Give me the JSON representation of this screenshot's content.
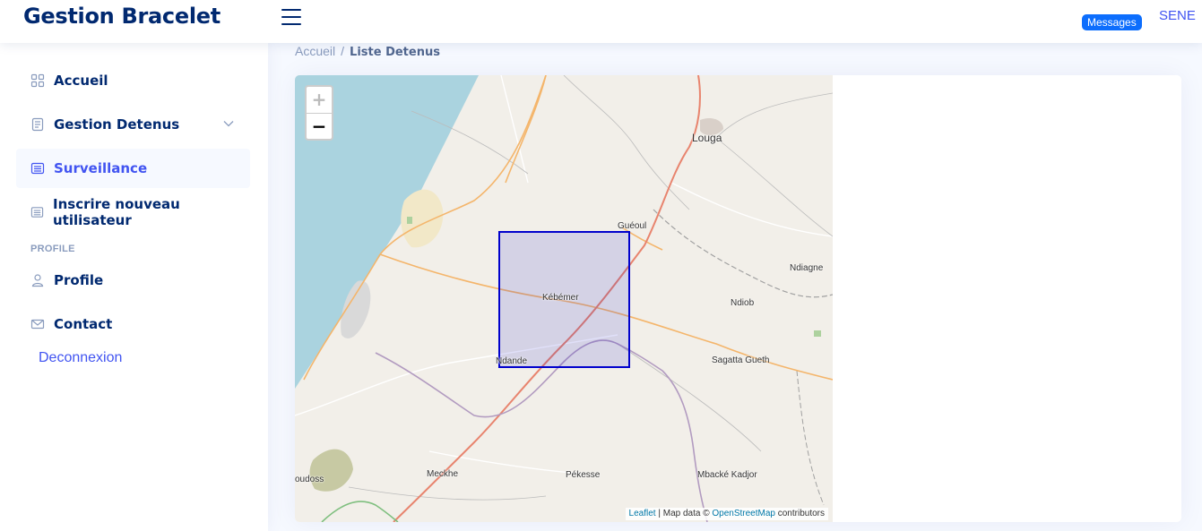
{
  "header": {
    "logo": "Gestion Bracelet",
    "messages_badge": "Messages",
    "user_name": "SENE"
  },
  "sidebar": {
    "items": [
      {
        "label": "Accueil",
        "icon": "grid-icon"
      },
      {
        "label": "Gestion Detenus",
        "icon": "document-list-icon",
        "has_submenu": true
      },
      {
        "label": "Surveillance",
        "icon": "list-icon",
        "active": true
      },
      {
        "label": "Inscrire nouveau utilisateur",
        "icon": "list-icon"
      }
    ],
    "heading_profile": "PROFILE",
    "profile_items": [
      {
        "label": "Profile",
        "icon": "person-icon"
      },
      {
        "label": "Contact",
        "icon": "envelope-icon"
      }
    ],
    "logout_label": "Deconnexion"
  },
  "breadcrumb": {
    "home": "Accueil",
    "separator": "/",
    "current": "Liste Detenus"
  },
  "map": {
    "zoom_in": "+",
    "zoom_out": "−",
    "attribution": {
      "leaflet": "Leaflet",
      "separator": " | Map data © ",
      "osm": "OpenStreetMap",
      "suffix": " contributors"
    },
    "places": [
      "Louga",
      "Guéoul",
      "Ndiagne",
      "Ndiob",
      "Kébémer",
      "Ndande",
      "Sagatta Gueth",
      "Meckhe",
      "Pékesse",
      "Mbacké Kadjor",
      "oudoss"
    ],
    "geofence_color": "#0000cc",
    "sea_color": "#aad3df",
    "land_color": "#f2efe9"
  }
}
